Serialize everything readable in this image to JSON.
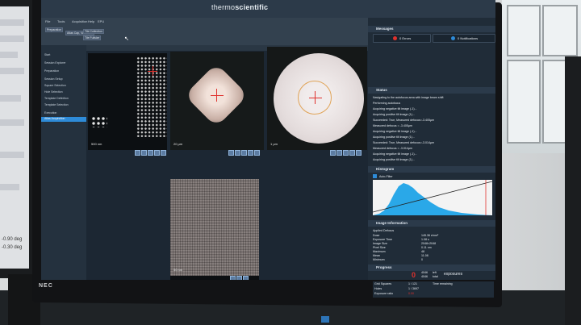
{
  "app": {
    "brand_light": "thermo",
    "brand_bold": "scientific",
    "ribbon_tabs": [
      "File",
      "Tools",
      "Acquisition",
      "Help",
      "EPU"
    ],
    "ribbon_buttons": [
      "Preparation",
      "Atlas Cap, Valve Ctrl",
      "Tile Collection",
      "Tile Fullsize"
    ]
  },
  "nav": {
    "items": [
      "Start",
      "Session Explorer",
      "Preparation",
      "Session Setup",
      "Square Selection",
      "Hole Selection",
      "Template Definition",
      "Template Selection",
      "Execution",
      "Atlas Acquisition"
    ],
    "active": "Atlas Acquisition"
  },
  "views": {
    "scale_1": "500 nm",
    "scale_2": "20 µm",
    "scale_3": "1 µm",
    "scale_4": "50 nm"
  },
  "messages": {
    "title": "Messages",
    "errors": "0 Errors",
    "notifications": "0 Notifications"
  },
  "status": {
    "title": "Status",
    "lines": [
      "Navigating to the autofocus area with image beam shift",
      "Performing autofocus",
      "Acquiring negative tilt image (-1)...",
      "Acquiring positive tilt image (1)...",
      "Succeeded: True, Measured defocus=-3.405µm",
      "Measured defocus = -3.405µm",
      "Acquiring negative tilt image (-1)...",
      "Acquiring positive tilt image (1)...",
      "Succeeded: True, Measured defocus=-3.014µm",
      "Measured defocus = -3.014µm",
      "Acquiring negative tilt image (-1)...",
      "Acquiring positive tilt image (1)..."
    ]
  },
  "histogram": {
    "title": "Histogram",
    "auto_filter": "Auto-Filter",
    "colors": {
      "fill": "#2aa8e8",
      "background": "#f3f3f3",
      "line": "#d8d8d8"
    }
  },
  "image_info": {
    "title": "Image Information",
    "rows": [
      {
        "label": "Applied Defocus",
        "value": ""
      },
      {
        "label": "Dose",
        "value": "145.36 e/nm²"
      },
      {
        "label": "Exposure Time",
        "value": "1.08 s"
      },
      {
        "label": "Image Size",
        "value": "2048×2048"
      },
      {
        "label": "Pixel Size",
        "value": "0.11 nm"
      },
      {
        "label": "Maximum",
        "value": "48"
      },
      {
        "label": "Mean",
        "value": "11.08"
      },
      {
        "label": "Minimum",
        "value": "0"
      }
    ]
  },
  "progress": {
    "title": "Progress",
    "big_number": "0",
    "acq_1": "4046",
    "acq_1_label": "left",
    "acq_2": "4046",
    "acq_2_label": "total",
    "unit": "exposures",
    "rows": [
      {
        "label": "Grid Squares",
        "value": "1 / 121"
      },
      {
        "label": "Holes",
        "value": "1 / 3697"
      },
      {
        "label": "Exposure ratio",
        "value": "0.00"
      }
    ],
    "time_label": "Time remaining"
  },
  "left_monitor": {
    "values": [
      "-0.90 deg",
      "-0.30 deg"
    ]
  },
  "bezel": {
    "brand": "NEC"
  },
  "colors": {
    "accent": "#2e8bd8",
    "error": "#e0312d",
    "screen_bg": "#1c2733"
  }
}
